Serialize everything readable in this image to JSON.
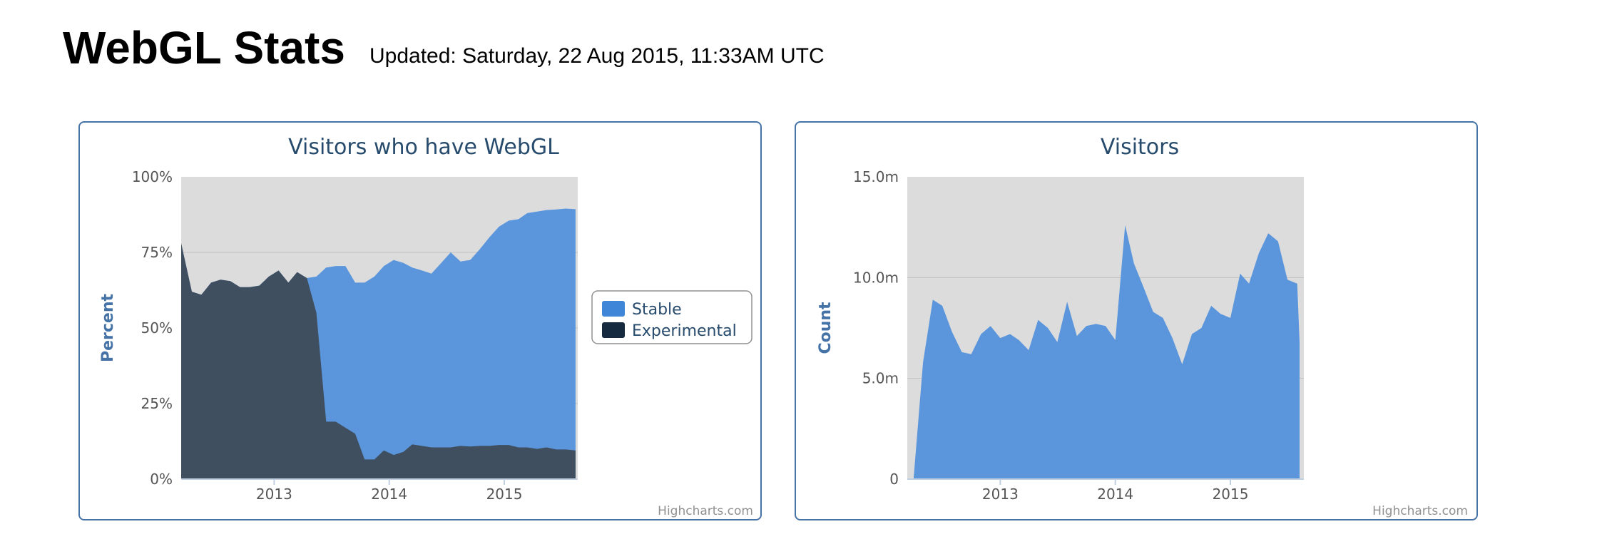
{
  "header": {
    "title": "WebGL Stats",
    "updated": "Updated: Saturday, 22 Aug 2015, 11:33AM UTC"
  },
  "colors": {
    "stable": "#5b96dc",
    "stable_legend": "#3f86d8",
    "experimental": "#3f4f5f",
    "experimental_legend": "#15293f",
    "plot_background": "#dcdcdc",
    "title": "#274b6d",
    "axis_label": "#4572a7",
    "tick": "#555555",
    "border": "#4572a7",
    "credits": "#909090"
  },
  "chart_data": [
    {
      "type": "area",
      "title": "Visitors who have WebGL",
      "ylabel": "Percent",
      "xlabel": "",
      "ylim": [
        0,
        100
      ],
      "xlim": [
        "2012-03-12",
        "2015-08-22"
      ],
      "x_ticks": [
        "2013",
        "2014",
        "2015"
      ],
      "y_ticks": [
        "0%",
        "25%",
        "50%",
        "75%",
        "100%"
      ],
      "grid": true,
      "legend_position": "right",
      "credits": "Highcharts.com",
      "series": [
        {
          "name": "Stable",
          "x": [
            "2012-03-12",
            "2012-04-15",
            "2012-05-15",
            "2012-06-15",
            "2012-07-15",
            "2012-08-15",
            "2012-09-15",
            "2012-10-15",
            "2012-11-15",
            "2012-12-15",
            "2013-01-15",
            "2013-02-15",
            "2013-03-15",
            "2013-04-15",
            "2013-05-15",
            "2013-06-15",
            "2013-07-15",
            "2013-08-15",
            "2013-09-15",
            "2013-10-15",
            "2013-11-15",
            "2013-12-15",
            "2014-01-15",
            "2014-02-15",
            "2014-03-15",
            "2014-04-15",
            "2014-05-15",
            "2014-06-15",
            "2014-07-15",
            "2014-08-15",
            "2014-09-15",
            "2014-10-15",
            "2014-11-15",
            "2014-12-15",
            "2015-01-15",
            "2015-02-15",
            "2015-03-15",
            "2015-04-15",
            "2015-05-15",
            "2015-06-15",
            "2015-07-15",
            "2015-08-15"
          ],
          "values": [
            78,
            62,
            61,
            65,
            66,
            65.5,
            63.5,
            63.5,
            64,
            67,
            69,
            65,
            68.5,
            66.5,
            67,
            70,
            70.5,
            70.5,
            65,
            65,
            67,
            70.5,
            72.5,
            71.5,
            70,
            69,
            68,
            71.5,
            75,
            72,
            72.5,
            76,
            80,
            83.5,
            85.5,
            86,
            88,
            88.5,
            89,
            89.2,
            89.5,
            89.3
          ]
        },
        {
          "name": "Experimental",
          "x": [
            "2012-03-12",
            "2012-04-15",
            "2012-05-15",
            "2012-06-15",
            "2012-07-15",
            "2012-08-15",
            "2012-09-15",
            "2012-10-15",
            "2012-11-15",
            "2012-12-15",
            "2013-01-15",
            "2013-02-15",
            "2013-03-15",
            "2013-04-15",
            "2013-05-15",
            "2013-06-15",
            "2013-07-15",
            "2013-08-15",
            "2013-09-15",
            "2013-10-15",
            "2013-11-15",
            "2013-12-15",
            "2014-01-15",
            "2014-02-15",
            "2014-03-15",
            "2014-04-15",
            "2014-05-15",
            "2014-06-15",
            "2014-07-15",
            "2014-08-15",
            "2014-09-15",
            "2014-10-15",
            "2014-11-15",
            "2014-12-15",
            "2015-01-15",
            "2015-02-15",
            "2015-03-15",
            "2015-04-15",
            "2015-05-15",
            "2015-06-15",
            "2015-07-15",
            "2015-08-15"
          ],
          "values": [
            78,
            62,
            61,
            65,
            66,
            65.5,
            63.5,
            63.5,
            64,
            67,
            69,
            65,
            68.5,
            66.5,
            55,
            19,
            19,
            17,
            15,
            6.5,
            6.5,
            9.5,
            8,
            9,
            11.5,
            11,
            10.5,
            10.5,
            10.5,
            11,
            10.8,
            11,
            11,
            11.3,
            11.3,
            10.5,
            10.5,
            10,
            10.5,
            9.8,
            9.8,
            9.5
          ]
        }
      ]
    },
    {
      "type": "area",
      "title": "Visitors",
      "ylabel": "Count",
      "xlabel": "",
      "ylim": [
        0,
        15000000
      ],
      "xlim": [
        "2012-03-12",
        "2015-08-22"
      ],
      "x_ticks": [
        "2013",
        "2014",
        "2015"
      ],
      "y_ticks": [
        "0",
        "5.0m",
        "10.0m",
        "15.0m"
      ],
      "grid": true,
      "credits": "Highcharts.com",
      "series": [
        {
          "name": "",
          "x": [
            "2012-04-01",
            "2012-05-01",
            "2012-06-01",
            "2012-07-01",
            "2012-08-01",
            "2012-09-01",
            "2012-10-01",
            "2012-11-01",
            "2012-12-01",
            "2013-01-01",
            "2013-02-01",
            "2013-03-01",
            "2013-04-01",
            "2013-05-01",
            "2013-06-01",
            "2013-07-01",
            "2013-08-01",
            "2013-09-01",
            "2013-10-01",
            "2013-11-01",
            "2013-12-01",
            "2014-01-01",
            "2014-02-01",
            "2014-03-01",
            "2014-04-01",
            "2014-05-01",
            "2014-06-01",
            "2014-07-01",
            "2014-08-01",
            "2014-09-01",
            "2014-10-01",
            "2014-11-01",
            "2014-12-01",
            "2015-01-01",
            "2015-02-01",
            "2015-03-01",
            "2015-04-01",
            "2015-05-01",
            "2015-06-01",
            "2015-07-01",
            "2015-08-01"
          ],
          "values": [
            0,
            5800000,
            8900000,
            8600000,
            7300000,
            6300000,
            6200000,
            7200000,
            7600000,
            7000000,
            7200000,
            6900000,
            6400000,
            7900000,
            7500000,
            6800000,
            8800000,
            7100000,
            7600000,
            7700000,
            7600000,
            6900000,
            12600000,
            10700000,
            9500000,
            8300000,
            8000000,
            7000000,
            5700000,
            7200000,
            7500000,
            8600000,
            8200000,
            8000000,
            10200000,
            9700000,
            11200000,
            12200000,
            11800000,
            9900000,
            9700000
          ]
        }
      ],
      "last_value": 6800000
    }
  ],
  "legend": {
    "stable": "Stable",
    "experimental": "Experimental"
  }
}
